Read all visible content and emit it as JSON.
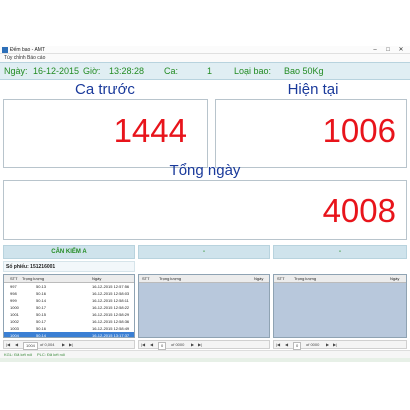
{
  "window": {
    "title": "Đếm bao - AMT",
    "controls": [
      "–",
      "□",
      "✕"
    ]
  },
  "menu": {
    "items": [
      "Tùy chỉnh",
      "Báo cáo"
    ]
  },
  "info": {
    "date_label": "Ngày:",
    "date_value": "16-12-2015",
    "time_label": "Giờ:",
    "time_value": "13:28:28",
    "shift_label": "Ca:",
    "shift_value": "1",
    "type_label": "Loại bao:",
    "type_value": "Bao 50Kg"
  },
  "panels": {
    "previous": {
      "label": "Ca trước",
      "value": "1444"
    },
    "current": {
      "label": "Hiện tại",
      "value": "1006"
    },
    "day_total": {
      "label": "Tổng ngày",
      "value": "4008"
    }
  },
  "sections": {
    "left": {
      "header": "CÂN KIỂM A",
      "slip_label": "Số phiếu: 151216001"
    },
    "middle": {
      "header": "-"
    },
    "right": {
      "header": "-"
    }
  },
  "table": {
    "columns": [
      "STT",
      "Trọng lượng",
      "Ngày"
    ],
    "rows": [
      [
        "997",
        "50.13",
        "16-12-2015 12:57:56"
      ],
      [
        "998",
        "50.16",
        "16-12-2015 12:58:03"
      ],
      [
        "999",
        "50.14",
        "16-12-2015 12:58:11"
      ],
      [
        "1000",
        "50.17",
        "16-12-2015 12:58:22"
      ],
      [
        "1001",
        "50.15",
        "16-12-2015 12:58:29"
      ],
      [
        "1002",
        "50.17",
        "16-12-2015 12:58:36"
      ],
      [
        "1003",
        "50.16",
        "16-12-2015 12:58:49"
      ],
      [
        "1004",
        "50.14",
        "16-12-2015 13:17:37"
      ]
    ],
    "selected_index": 7
  },
  "pagers": {
    "left": {
      "first": "|◀",
      "prev": "◀",
      "page": "1004",
      "of": "of 0,004",
      "next": "▶",
      "last": "▶|"
    },
    "middle": {
      "first": "|◀",
      "prev": "◀",
      "page": "0",
      "of": "of 0000",
      "next": "▶",
      "last": "▶|"
    },
    "right": {
      "first": "|◀",
      "prev": "◀",
      "page": "0",
      "of": "of 0000",
      "next": "▶",
      "last": "▶|"
    }
  },
  "status": {
    "left": "KGL: Đã kết nối",
    "right": "PLC: Đã kết nối"
  },
  "colors": {
    "label_green": "#228b22",
    "number_red": "#e8141b",
    "title_blue": "#1a3a9b",
    "header_bg": "#cfe3ec",
    "selection": "#3a7fd4"
  }
}
